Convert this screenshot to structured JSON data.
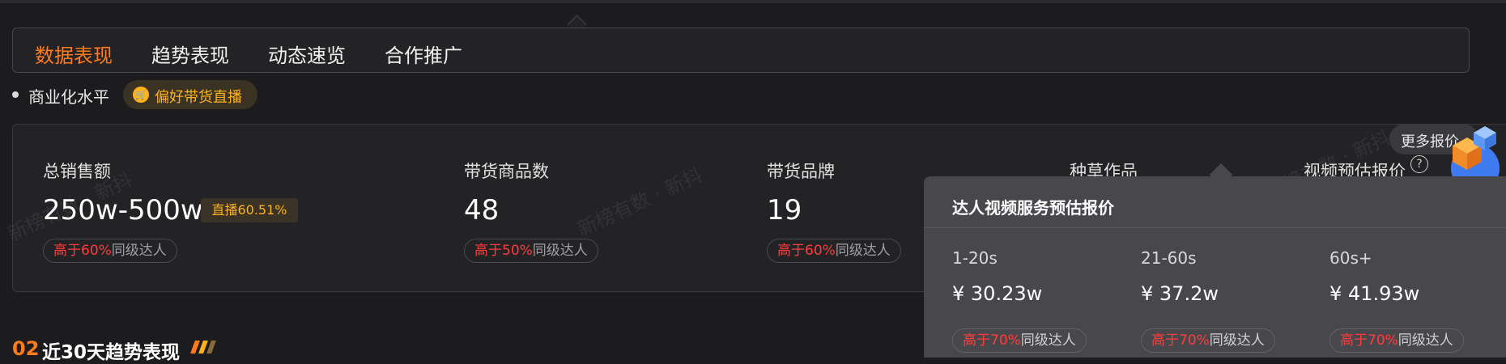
{
  "tabs": [
    {
      "label": "数据表现",
      "active": true
    },
    {
      "label": "趋势表现",
      "active": false
    },
    {
      "label": "动态速览",
      "active": false
    },
    {
      "label": "合作推广",
      "active": false
    }
  ],
  "tags": {
    "commerce_level": "商业化水平",
    "preference": "偏好带货直播"
  },
  "metrics": [
    {
      "label": "总销售额",
      "value": "250w-500w",
      "badge": "直播60.51%",
      "compare_hi": "高于60%",
      "compare_rest": "同级达人"
    },
    {
      "label": "带货商品数",
      "value": "48",
      "compare_hi": "高于50%",
      "compare_rest": "同级达人"
    },
    {
      "label": "带货品牌",
      "value": "19",
      "compare_hi": "高于60%",
      "compare_rest": "同级达人"
    },
    {
      "label": "种草作品"
    },
    {
      "label": "视频预估报价"
    }
  ],
  "more_quotes": "更多报价",
  "watermark": "新榜有数 · 新抖",
  "popover": {
    "title": "达人视频服务预估报价",
    "columns": [
      {
        "duration": "1-20s",
        "price": "¥ 30.23w",
        "compare_hi": "高于70%",
        "compare_rest": "同级达人"
      },
      {
        "duration": "21-60s",
        "price": "¥ 37.2w",
        "compare_hi": "高于70%",
        "compare_rest": "同级达人"
      },
      {
        "duration": "60s+",
        "price": "¥ 41.93w",
        "compare_hi": "高于70%",
        "compare_rest": "同级达人"
      }
    ]
  },
  "section": {
    "number": "02",
    "title": "近30天趋势表现"
  },
  "colors": {
    "accent": "#ff7a1a",
    "highlight_red": "#ff3b3b",
    "gold": "#ffb21a",
    "background": "#1c1c1f"
  }
}
